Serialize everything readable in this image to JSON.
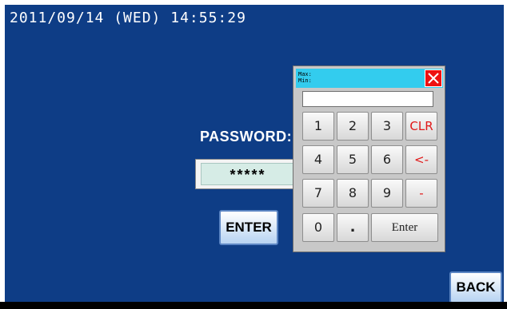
{
  "header": {
    "datetime": "2011/09/14 (WED) 14:55:29"
  },
  "login": {
    "password_label": "PASSWORD:",
    "password_value": "*****",
    "enter_label": "ENTER"
  },
  "footer": {
    "back_label": "BACK"
  },
  "keypad": {
    "max_label": "Max:",
    "min_label": "Min:",
    "display_value": "",
    "close_icon": "close-icon",
    "keys": {
      "k1": "1",
      "k2": "2",
      "k3": "3",
      "clr": "CLR",
      "k4": "4",
      "k5": "5",
      "k6": "6",
      "backspace": "<-",
      "k7": "7",
      "k8": "8",
      "k9": "9",
      "minus": "-",
      "k0": "0",
      "dot": ".",
      "enter": "Enter"
    }
  },
  "colors": {
    "background": "#0e3d86",
    "keypad_title": "#33ccee",
    "close_button": "#ee1111",
    "function_key_text": "#e01818"
  }
}
